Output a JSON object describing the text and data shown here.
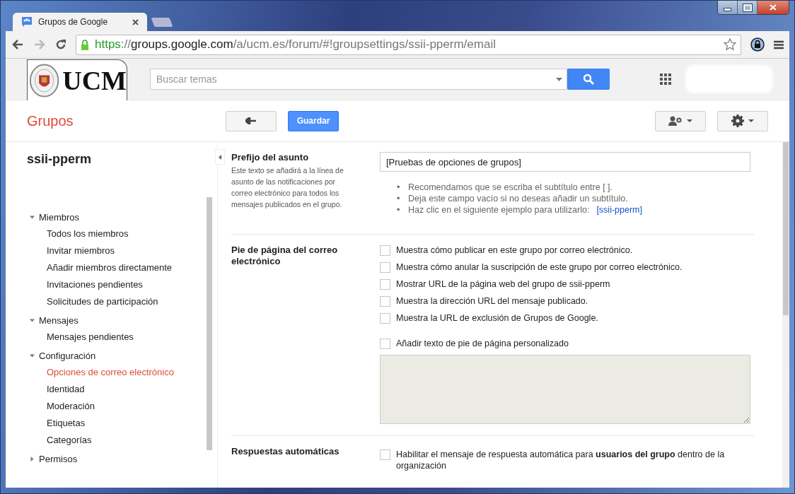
{
  "browser": {
    "tabs": [
      {
        "title": "Grupos de Google",
        "selected": true
      }
    ],
    "address": {
      "scheme": "https",
      "separator": "://",
      "host": "groups.google.com",
      "path": "/a/ucm.es/forum/#!groupsettings/ssii-pperm/email"
    }
  },
  "header": {
    "logo": "UCM",
    "search": {
      "placeholder": "Buscar temas"
    }
  },
  "toolbar": {
    "app_title": "Grupos",
    "save": "Guardar"
  },
  "sidebar": {
    "group_name": "ssii-pperm",
    "items": [
      {
        "label": "Miembros",
        "expanded": true,
        "children": [
          {
            "label": "Todos los miembros",
            "selected": false
          },
          {
            "label": "Invitar miembros",
            "selected": false
          },
          {
            "label": "Añadir miembros directamente",
            "selected": false
          },
          {
            "label": "Invitaciones pendientes",
            "selected": false
          },
          {
            "label": "Solicitudes de participación",
            "selected": false
          }
        ]
      },
      {
        "label": "Mensajes",
        "expanded": true,
        "children": [
          {
            "label": "Mensajes pendientes",
            "selected": false
          }
        ]
      },
      {
        "label": "Configuración",
        "expanded": true,
        "children": [
          {
            "label": "Opciones de correo electrónico",
            "selected": true
          },
          {
            "label": "Identidad",
            "selected": false
          },
          {
            "label": "Moderación",
            "selected": false
          },
          {
            "label": "Etiquetas",
            "selected": false
          },
          {
            "label": "Categorías",
            "selected": false
          }
        ]
      },
      {
        "label": "Permisos",
        "expanded": false
      }
    ]
  },
  "sections": [
    {
      "kind": "prefix",
      "title": "Prefijo del asunto",
      "description": "Este texto se añadirá a la línea de asunto de las notificaciones por correo electrónico para todos los mensajes publicados en el grupo.",
      "value": "[Pruebas de opciones de grupos]",
      "marker": "•",
      "hints": [
        "Recomendamos que se escriba el subtítulo entre [ ].",
        "Deja este campo vacío si no deseas añadir un subtítulo.",
        "Haz clic en el siguiente ejemplo para utilizarlo:"
      ],
      "example": "[ssii-pperm]"
    },
    {
      "kind": "footer",
      "title": "Pie de página del correo electrónico",
      "options": [
        {
          "label": "Muestra cómo publicar en este grupo por correo electrónico.",
          "checked": false
        },
        {
          "label": "Muestra cómo anular la suscripción de este grupo por correo electrónico.",
          "checked": false
        },
        {
          "label": "Mostrar URL de la página web del grupo de ssii-pperm",
          "checked": false
        },
        {
          "label": "Muestra la dirección URL del mensaje publicado.",
          "checked": false
        },
        {
          "label": "Muestra la URL de exclusión de Grupos de Google.",
          "checked": false
        }
      ],
      "custom": {
        "label": "Añadir texto de pie de página personalizado",
        "checked": false
      },
      "textarea": {
        "disabled": true
      }
    },
    {
      "kind": "autoreply",
      "title": "Respuestas automáticas",
      "options": [
        {
          "label": "Habilitar el mensaje de respuesta automática para **usuarios del grupo** dentro de la organización",
          "checked": false
        }
      ]
    }
  ]
}
